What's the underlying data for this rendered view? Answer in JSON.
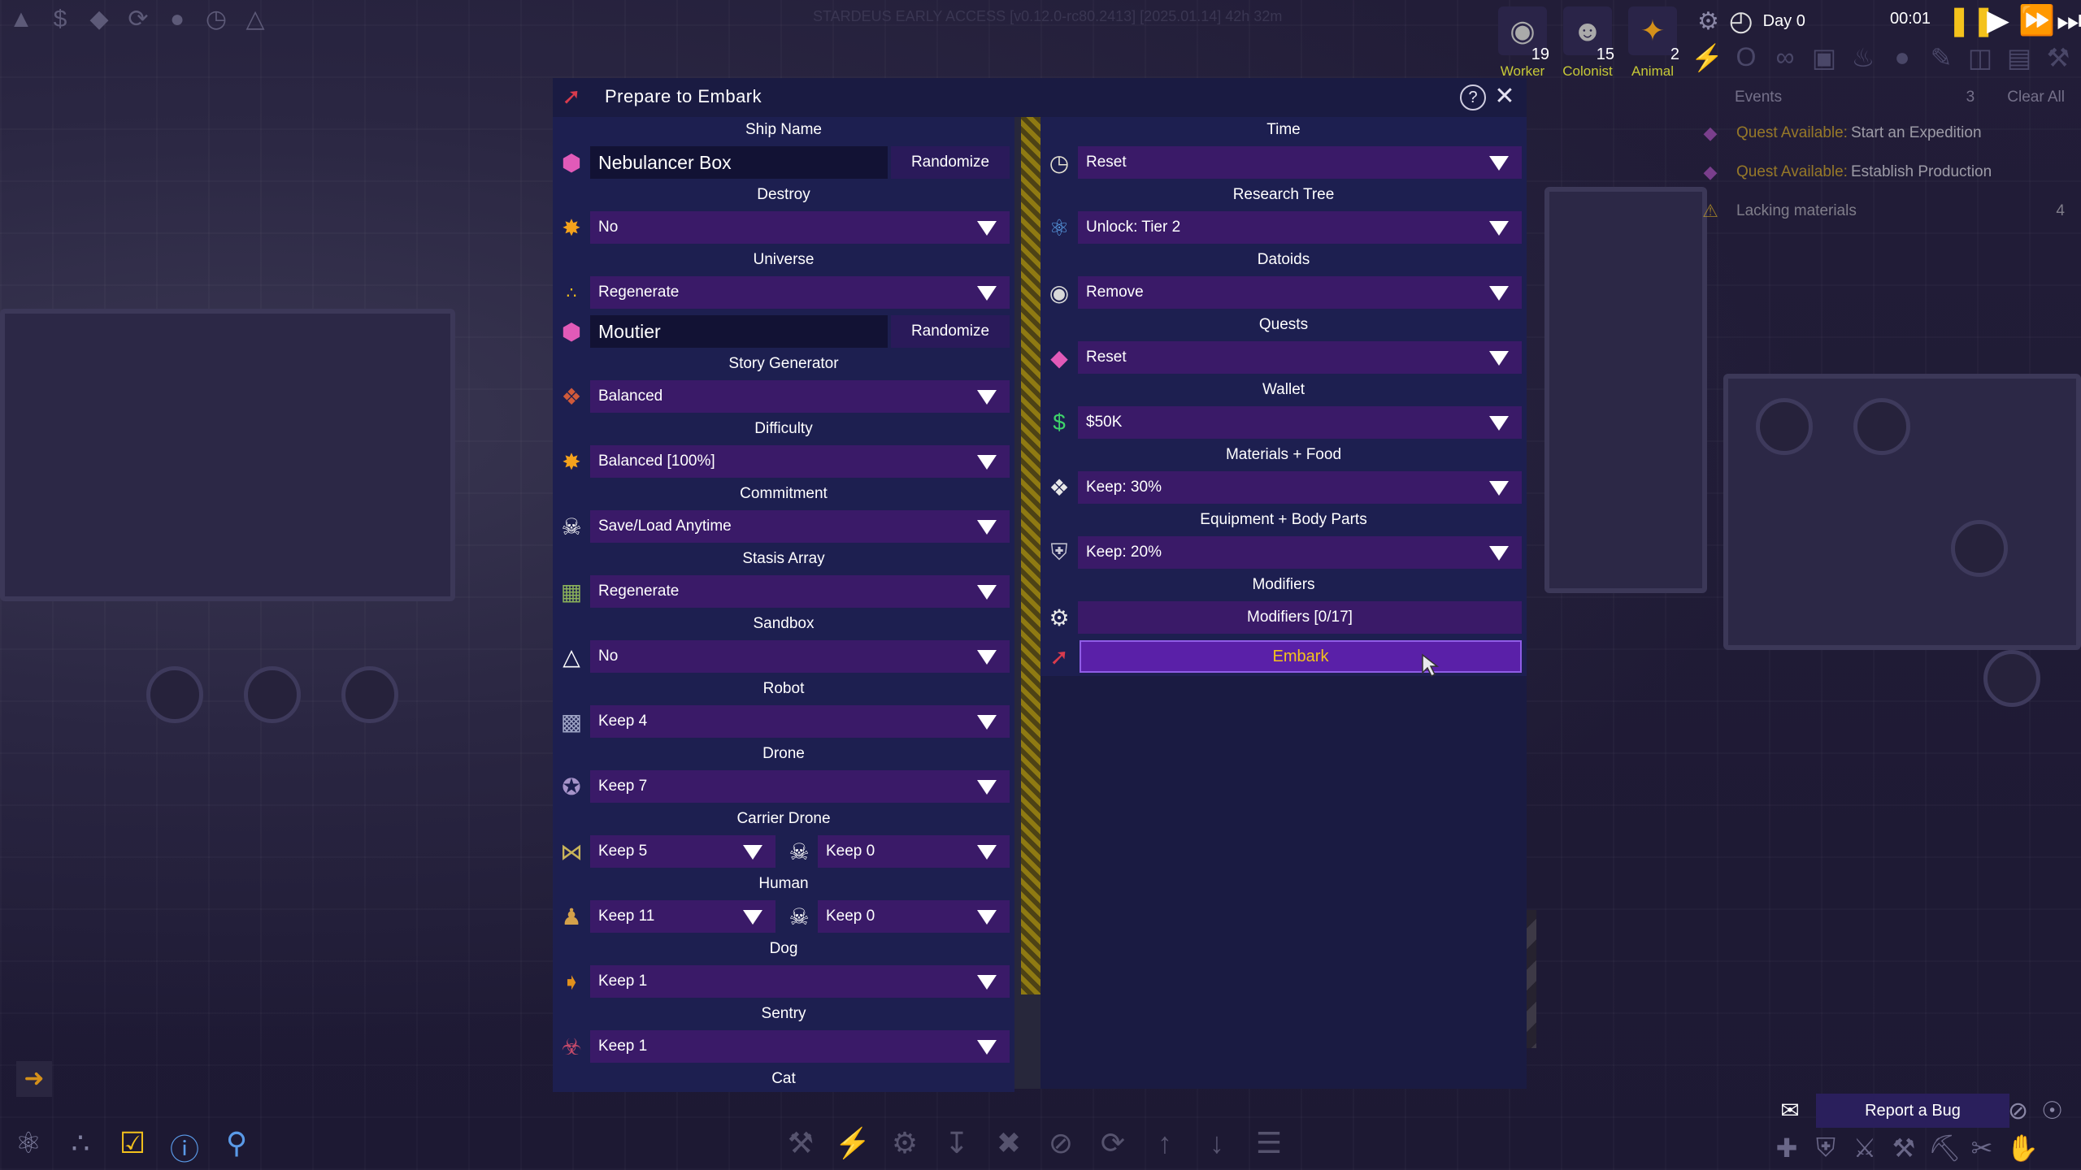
{
  "build_info": "STARDEUS EARLY ACCESS [v0.12.0-rc80.2413] [2025.01.14] 42h 32m",
  "population": [
    {
      "label": "Worker",
      "count": "19",
      "icon": "robot-head-icon"
    },
    {
      "label": "Colonist",
      "count": "15",
      "icon": "colonist-icon"
    },
    {
      "label": "Animal",
      "count": "2",
      "icon": "dog-icon"
    }
  ],
  "clock": {
    "day": "Day 0",
    "time": "00:01"
  },
  "events": {
    "title": "Events",
    "count": "3",
    "clear_all": "Clear All",
    "items": [
      {
        "prefix": "Quest Available:",
        "text": "Start an Expedition"
      },
      {
        "prefix": "Quest Available:",
        "text": "Establish Production"
      },
      {
        "prefix": "",
        "text": "Lacking materials",
        "num": "4"
      }
    ]
  },
  "modal": {
    "title": "Prepare to Embark",
    "left": {
      "ship_name_label": "Ship Name",
      "ship_name_value": "Nebulancer Box",
      "randomize": "Randomize",
      "destroy_label": "Destroy",
      "destroy_value": "No",
      "universe_label": "Universe",
      "universe_value": "Regenerate",
      "universe_name_value": "Moutier",
      "story_label": "Story Generator",
      "story_value": "Balanced",
      "difficulty_label": "Difficulty",
      "difficulty_value": "Balanced [100%]",
      "commitment_label": "Commitment",
      "commitment_value": "Save/Load Anytime",
      "stasis_label": "Stasis Array",
      "stasis_value": "Regenerate",
      "sandbox_label": "Sandbox",
      "sandbox_value": "No",
      "robot_label": "Robot",
      "robot_value": "Keep 4",
      "drone_label": "Drone",
      "drone_value": "Keep 7",
      "carrier_label": "Carrier Drone",
      "carrier_value": "Keep 5",
      "carrier_dead_value": "Keep 0",
      "human_label": "Human",
      "human_value": "Keep 11",
      "human_dead_value": "Keep 0",
      "dog_label": "Dog",
      "dog_value": "Keep 1",
      "sentry_label": "Sentry",
      "sentry_value": "Keep 1",
      "cat_label": "Cat"
    },
    "right": {
      "time_label": "Time",
      "time_value": "Reset",
      "research_label": "Research Tree",
      "research_value": "Unlock: Tier 2",
      "datoids_label": "Datoids",
      "datoids_value": "Remove",
      "quests_label": "Quests",
      "quests_value": "Reset",
      "wallet_label": "Wallet",
      "wallet_value": "$50K",
      "materials_label": "Materials + Food",
      "materials_value": "Keep: 30%",
      "equipment_label": "Equipment + Body Parts",
      "equipment_value": "Keep: 20%",
      "modifiers_label": "Modifiers",
      "modifiers_button": "Modifiers [0/17]",
      "embark_button": "Embark"
    }
  },
  "report_bug": "Report a Bug",
  "colors": {
    "accent_yellow": "#f4c21c",
    "select_purple": "#3a1a68",
    "panel_bg": "#1d1f50"
  }
}
